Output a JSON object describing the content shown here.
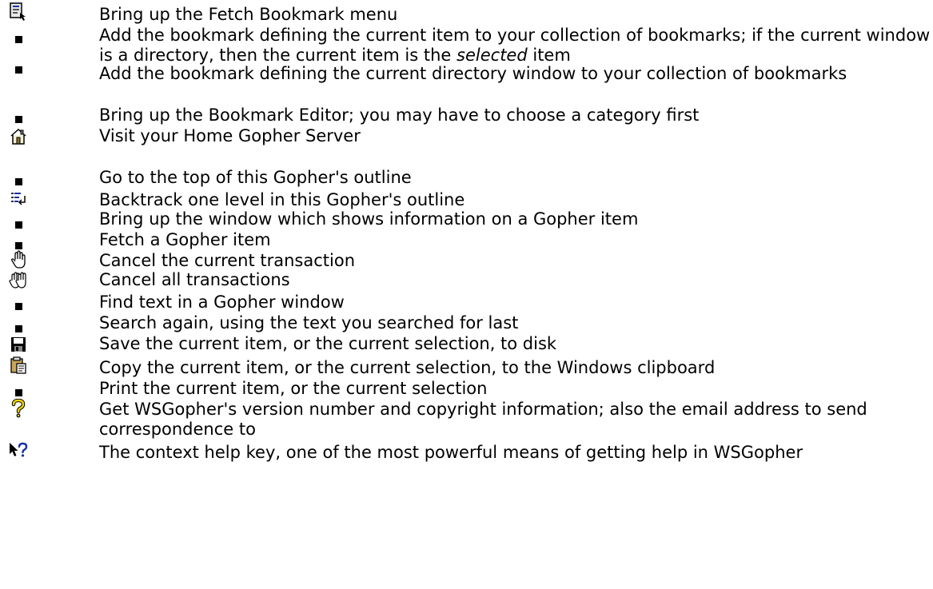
{
  "items": [
    {
      "icon": "fetch-bookmark-icon",
      "text": "Bring up the Fetch Bookmark menu"
    },
    {
      "icon": "bullet-icon",
      "text_before": "Add the bookmark defining the current item to your collection of bookmarks; if the current window is a directory, then the current item is the ",
      "text_em": "selected",
      "text_after": " item"
    },
    {
      "icon": "bullet-icon",
      "text": "Add the bookmark defining the current directory window to your collection of bookmarks"
    },
    {
      "icon": "bullet-icon",
      "text": "Bring up the Bookmark Editor; you may have to choose a category first"
    },
    {
      "icon": "home-icon",
      "text": "Visit your Home Gopher Server"
    },
    {
      "icon": "bullet-icon",
      "text": "Go to the top of this Gopher's outline"
    },
    {
      "icon": "backtrack-icon",
      "text": "Backtrack one level in this Gopher's outline"
    },
    {
      "icon": "bullet-icon",
      "text": "Bring up the window which shows information on a Gopher item"
    },
    {
      "icon": "bullet-icon",
      "text": "Fetch a Gopher item"
    },
    {
      "icon": "hand-stop-icon",
      "text": "Cancel the current transaction"
    },
    {
      "icon": "double-hand-stop-icon",
      "text": "Cancel all transactions"
    },
    {
      "icon": "bullet-icon",
      "text": "Find text in a Gopher window"
    },
    {
      "icon": "bullet-icon",
      "text": "Search again, using the text you searched for last"
    },
    {
      "icon": "floppy-disk-icon",
      "text": "Save the current item, or the current selection, to disk"
    },
    {
      "icon": "clipboard-icon",
      "text": "Copy the current item, or the current selection, to the Windows clipboard"
    },
    {
      "icon": "bullet-icon",
      "text": "Print the current item, or the current selection"
    },
    {
      "icon": "question-mark-icon",
      "text": "Get WSGopher's version number and copyright information; also the email address to send correspondence to"
    },
    {
      "icon": "context-help-icon",
      "text": "The context help key, one of the most powerful means of getting help in WSGopher"
    }
  ]
}
